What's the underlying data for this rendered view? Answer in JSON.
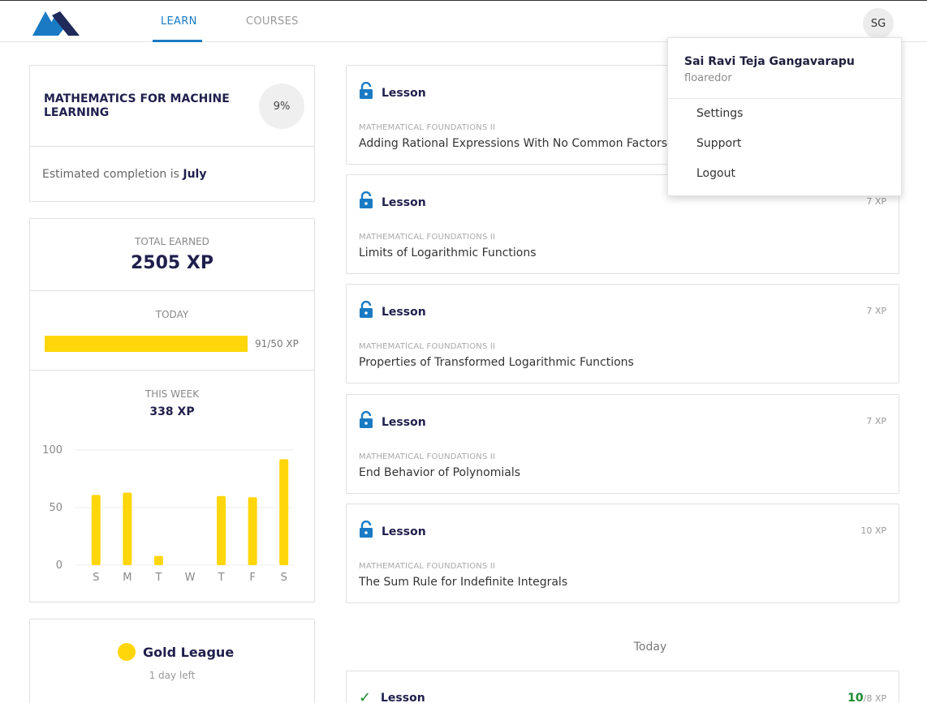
{
  "nav": {
    "tabs": [
      {
        "label": "LEARN",
        "active": true
      },
      {
        "label": "COURSES",
        "active": false
      }
    ],
    "avatar_initials": "SG",
    "accent_color": "#1a7bc4"
  },
  "course": {
    "title": "MATHEMATICS FOR MACHINE LEARNING",
    "progress": "9%",
    "estimated_prefix": "Estimated completion is",
    "estimated_month": "July"
  },
  "xp": {
    "total_label": "TOTAL EARNED",
    "total_value": "2505 XP",
    "today_label": "TODAY",
    "today_value": "91/50 XP",
    "today_fill_fraction": 1.0,
    "week_label": "THIS WEEK",
    "week_value": "338 XP"
  },
  "chart_data": {
    "type": "bar",
    "categories": [
      "S",
      "M",
      "T",
      "W",
      "T",
      "F",
      "S"
    ],
    "values": [
      61,
      63,
      8,
      0,
      60,
      59,
      92
    ],
    "yticks": [
      0,
      50,
      100
    ],
    "ylim": [
      0,
      100
    ],
    "grid": true,
    "bar_color": "#ffd60a"
  },
  "league": {
    "name": "Gold League",
    "time_left": "1 day left",
    "color": "#ffd60a"
  },
  "lessons": [
    {
      "kind": "Lesson",
      "xp": "",
      "subject": "MATHEMATICAL FOUNDATIONS II",
      "title": "Adding Rational Expressions With No Common Factors"
    },
    {
      "kind": "Lesson",
      "xp": "7 XP",
      "subject": "MATHEMATICAL FOUNDATIONS II",
      "title": "Limits of Logarithmic Functions"
    },
    {
      "kind": "Lesson",
      "xp": "7 XP",
      "subject": "MATHEMATICAL FOUNDATIONS II",
      "title": "Properties of Transformed Logarithmic Functions"
    },
    {
      "kind": "Lesson",
      "xp": "7 XP",
      "subject": "MATHEMATICAL FOUNDATIONS II",
      "title": "End Behavior of Polynomials"
    },
    {
      "kind": "Lesson",
      "xp": "10 XP",
      "subject": "MATHEMATICAL FOUNDATIONS II",
      "title": "The Sum Rule for Indefinite Integrals"
    }
  ],
  "today_heading": "Today",
  "completed": {
    "kind": "Lesson",
    "xp_earned": "10",
    "xp_total": "/8 XP",
    "earned_color": "#1a8a2e"
  },
  "user_menu": {
    "name": "Sai Ravi Teja Gangavarapu",
    "username": "floaredor",
    "items": [
      "Settings",
      "Support",
      "Logout"
    ]
  }
}
